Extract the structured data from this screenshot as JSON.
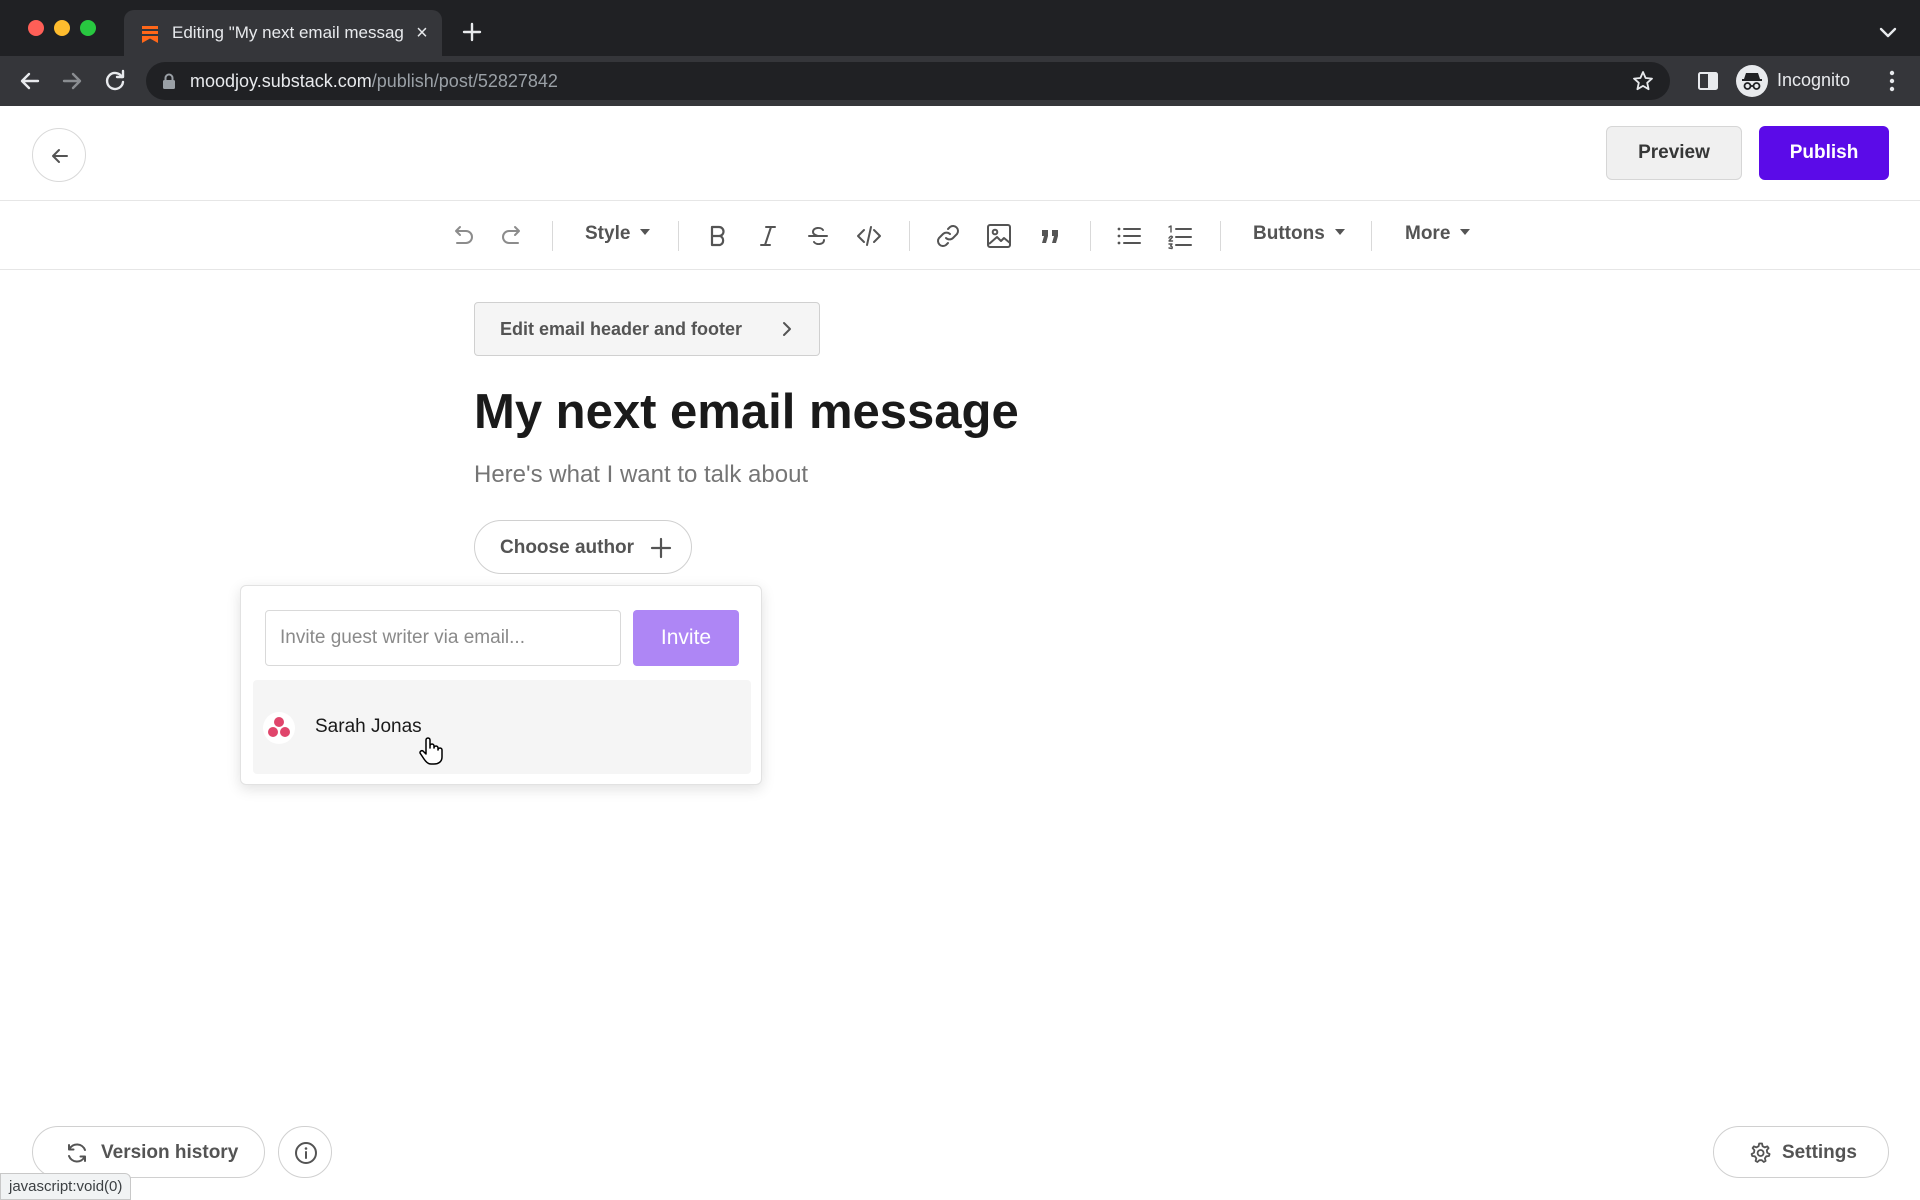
{
  "browser": {
    "tab_title": "Editing \"My next email message\"",
    "tab_close": "×",
    "url_host": "moodjoy.substack.com",
    "url_path": "/publish/post/52827842",
    "profile_label": "Incognito",
    "status_text": "javascript:void(0)"
  },
  "header": {
    "preview_label": "Preview",
    "publish_label": "Publish",
    "publish_color": "#5b0be8"
  },
  "format_toolbar": {
    "style_label": "Style",
    "buttons_label": "Buttons",
    "more_label": "More"
  },
  "editor": {
    "edit_header_footer_label": "Edit email header and footer",
    "title": "My next email message",
    "subtitle": "Here's what I want to talk about",
    "choose_author_label": "Choose author"
  },
  "author_popover": {
    "invite_placeholder": "Invite guest writer via email...",
    "invite_label": "Invite",
    "authors": [
      {
        "name": "Sarah Jonas"
      }
    ]
  },
  "footer": {
    "version_history_label": "Version history",
    "settings_label": "Settings"
  }
}
